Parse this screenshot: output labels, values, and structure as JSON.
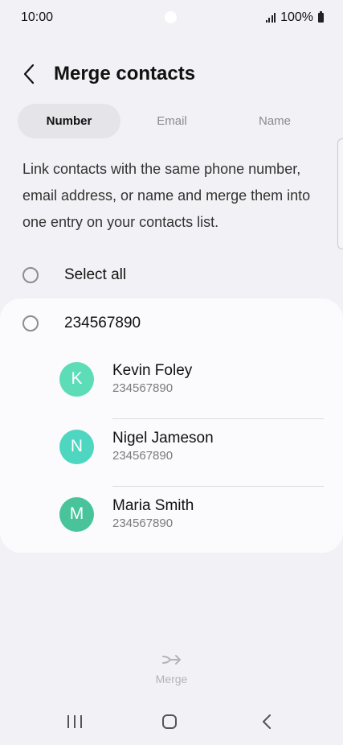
{
  "status": {
    "time": "10:00",
    "battery": "100%"
  },
  "header": {
    "title": "Merge contacts"
  },
  "tabs": [
    {
      "label": "Number",
      "active": true
    },
    {
      "label": "Email",
      "active": false
    },
    {
      "label": "Name",
      "active": false
    }
  ],
  "description": "Link contacts with the same phone number, email address, or name and merge them into one entry on your contacts list.",
  "select_all": {
    "label": "Select all"
  },
  "group": {
    "number": "234567890",
    "contacts": [
      {
        "initial": "K",
        "name": "Kevin Foley",
        "phone": "234567890",
        "color": "#5ddcb8"
      },
      {
        "initial": "N",
        "name": "Nigel Jameson",
        "phone": "234567890",
        "color": "#4fd6c0"
      },
      {
        "initial": "M",
        "name": "Maria Smith",
        "phone": "234567890",
        "color": "#49c49a"
      }
    ]
  },
  "bottom_action": {
    "label": "Merge",
    "icon": "merge-arrow-icon",
    "enabled": false
  },
  "colors": {
    "background": "#f2f2f6",
    "card": "#fbfbfd",
    "disabled": "#b3b3b8"
  }
}
